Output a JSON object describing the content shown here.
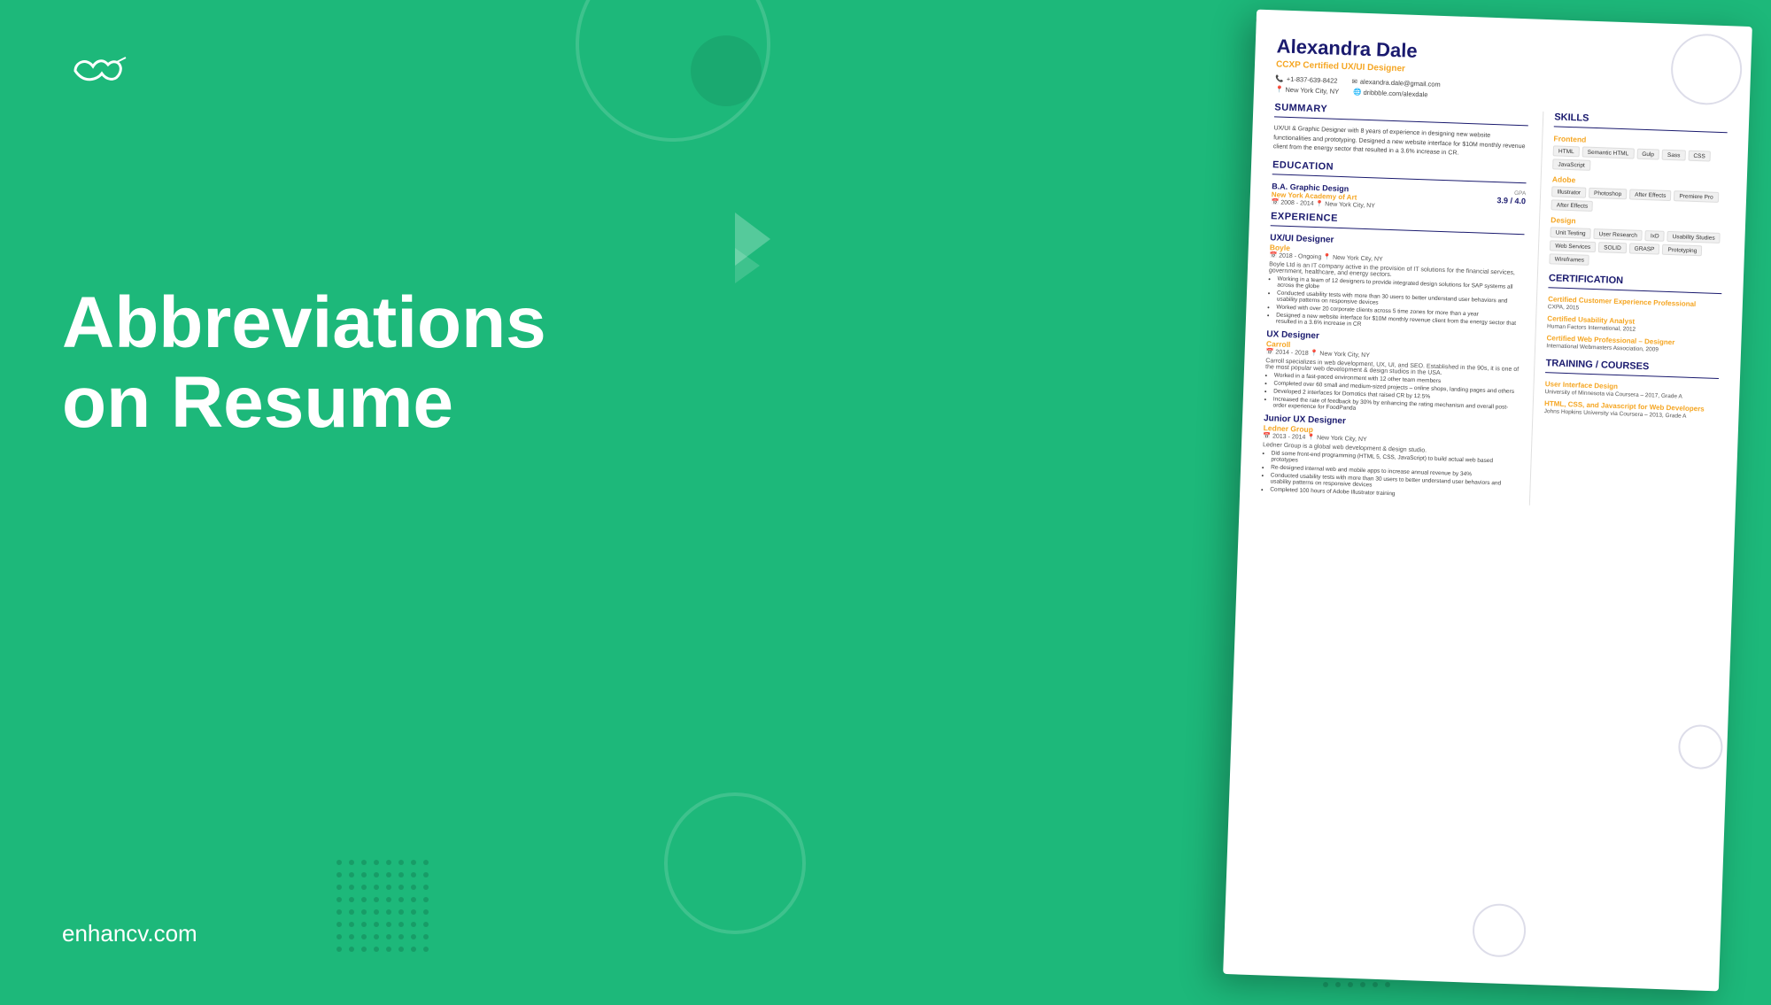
{
  "logo": {
    "alt": "enhancv logo"
  },
  "heading": {
    "line1": "Abbreviations",
    "line2": "on Resume"
  },
  "website": "enhancv.com",
  "resume": {
    "name": "Alexandra Dale",
    "title": "CCXP Certified UX/UI Designer",
    "phone": "+1-837-639-8422",
    "email": "alexandra.dale@gmail.com",
    "location": "New York City, NY",
    "portfolio": "dribbble.com/alexdale",
    "summary": {
      "heading": "SUMMARY",
      "text": "UX/UI & Graphic Designer with 8 years of experience in designing new website functionalities and prototyping. Designed a new website interface for $10M monthly revenue client from the energy sector that resulted in a 3.6% increase in CR."
    },
    "education": {
      "heading": "EDUCATION",
      "degree": "B.A. Graphic Design",
      "school": "New York Academy of Art",
      "years": "2008 - 2014",
      "location": "New York City, NY",
      "gpa_label": "GPA",
      "gpa": "3.9 / 4.0"
    },
    "experience": {
      "heading": "EXPERIENCE",
      "jobs": [
        {
          "title": "UX/UI Designer",
          "company": "Boyle",
          "period": "2018 - Ongoing",
          "location": "New York City, NY",
          "description": "Boyle Ltd is an IT company active in the provision of IT solutions for the financial services, government, healthcare, and energy sectors.",
          "bullets": [
            "Working in a team of 12 designers to provide integrated design solutions for SAP systems all across the globe",
            "Conducted usability tests with more than 30 users to better understand user behaviors and usability patterns on responsive devices",
            "Worked with over 20 corporate clients across 5 time zones for more than a year",
            "Designed a new website interface for $10M monthly revenue client from the energy sector that resulted in a 3.6% increase in CR"
          ]
        },
        {
          "title": "UX Designer",
          "company": "Carroll",
          "period": "2014 - 2018",
          "location": "New York City, NY",
          "description": "Carroll specializes in web development, UX, UI, and SEO. Established in the 90s, it is one of the most popular web development & design studios in the USA.",
          "bullets": [
            "Worked in a fast-paced environment with 12 other team members",
            "Completed over 60 small and medium-sized projects – online shops, landing pages and others",
            "Developed 2 interfaces for Domotics that raised CR by 12.5%",
            "Increased the rate of feedback by 30% by enhancing the rating mechanism and overall post-order experience for FoodPanda"
          ]
        },
        {
          "title": "Junior UX Designer",
          "company": "Ledner Group",
          "period": "2013 - 2014",
          "location": "New York City, NY",
          "description": "Ledner Group is a global web development & design studio.",
          "bullets": [
            "Did some front-end programming (HTML 5, CSS, JavaScript) to build actual web based prototypes",
            "Re-designed internal web and mobile apps to increase annual revenue by 34%",
            "Conducted usability tests with more than 30 users to better understand user behaviors and usability patterns on responsive devices",
            "Completed 100 hours of Adobe Illustrator training"
          ]
        }
      ]
    },
    "skills": {
      "heading": "SKILLS",
      "categories": [
        {
          "name": "Frontend",
          "tags": [
            "HTML",
            "Semantic HTML",
            "Gulp",
            "Sass",
            "CSS",
            "JavaScript"
          ]
        },
        {
          "name": "Adobe",
          "tags": [
            "Illustrator",
            "Photoshop",
            "After Effects",
            "Premiere Pro",
            "After Effects"
          ]
        },
        {
          "name": "Design",
          "tags": [
            "Unit Testing",
            "User Research",
            "IxD",
            "Usability Studies",
            "Web Services",
            "SOLID",
            "GRASP",
            "Prototyping",
            "Wireframes"
          ]
        }
      ]
    },
    "certification": {
      "heading": "CERTIFICATION",
      "certs": [
        {
          "title": "Certified Customer Experience Professional",
          "org": "CXPA, 2015"
        },
        {
          "title": "Certified Usability Analyst",
          "org": "Human Factors International, 2012"
        },
        {
          "title": "Certified Web Professional – Designer",
          "org": "International Webmasters Association, 2009"
        }
      ]
    },
    "training": {
      "heading": "TRAINING / COURSES",
      "courses": [
        {
          "title": "User Interface Design",
          "detail": "University of Minnesota via Coursera – 2017, Grade A"
        },
        {
          "title": "HTML, CSS, and Javascript for Web Developers",
          "detail": "Johns Hopkins University via Coursera – 2013, Grade A"
        }
      ]
    }
  }
}
